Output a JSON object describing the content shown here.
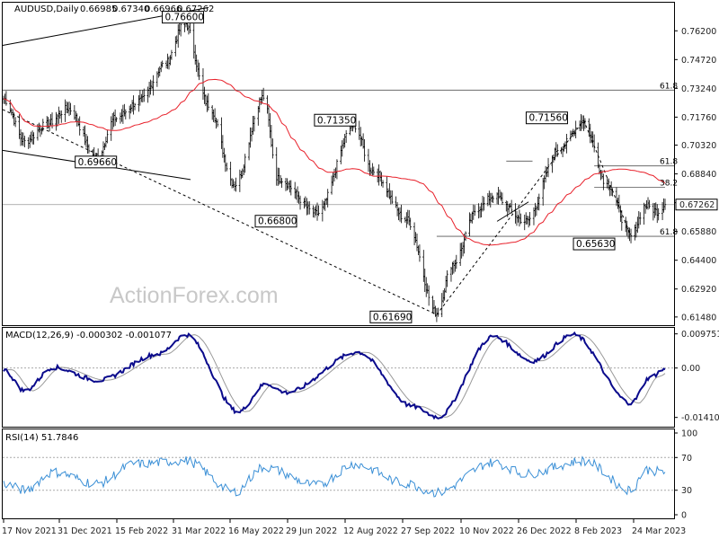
{
  "chart_data": {
    "type": "candlestick",
    "header": {
      "symbol": "AUDUSD,Daily",
      "ohlc": [
        "0.66985",
        "0.67340",
        "0.66966",
        "0.67262"
      ]
    },
    "watermark": "ActionForex.com",
    "colors": {
      "candle": "#000000",
      "sma": "#e8202a",
      "macd_main": "#0a0a8c",
      "macd_signal": "#999999",
      "rsi": "#3a8fd6",
      "levels": "#000000"
    },
    "x_axis": {
      "labels": [
        "17 Nov 2021",
        "31 Dec 2021",
        "15 Feb 2022",
        "31 Mar 2022",
        "16 May 2022",
        "29 Jun 2022",
        "12 Aug 2022",
        "27 Sep 2022",
        "10 Nov 2022",
        "26 Dec 2022",
        "8 Feb 2023",
        "24 Mar 2023"
      ]
    },
    "price_panel": {
      "ylim": [
        0.6115,
        0.776
      ],
      "ticks": [
        "0.76200",
        "0.74720",
        "0.73240",
        "0.71760",
        "0.70320",
        "0.68840",
        "0.67360",
        "0.65880",
        "0.64400",
        "0.62920",
        "0.61480"
      ],
      "current_price": "0.67262",
      "swing_labels": [
        {
          "text": "0.76600",
          "date": "2022-04-04",
          "price": 0.766
        },
        {
          "text": "0.69660",
          "date": "2022-01-27",
          "price": 0.6966
        },
        {
          "text": "0.71350",
          "date": "2022-08-11",
          "price": 0.7135
        },
        {
          "text": "0.66800",
          "date": "2022-07-14",
          "price": 0.668
        },
        {
          "text": "0.61690",
          "date": "2022-10-13",
          "price": 0.6169
        },
        {
          "text": "0.71560",
          "date": "2023-02-02",
          "price": 0.7156
        },
        {
          "text": "0.65630",
          "date": "2023-03-10",
          "price": 0.6563
        }
      ],
      "fib_labels": [
        {
          "text": "61.8",
          "price": 0.7315
        },
        {
          "text": "61.8",
          "price": 0.6925
        },
        {
          "text": "38.2",
          "price": 0.6815
        },
        {
          "text": "61.8",
          "price": 0.6563
        }
      ],
      "key_candles": [
        {
          "date": "2021-11-17",
          "close": 0.727
        },
        {
          "date": "2021-12-03",
          "close": 0.705
        },
        {
          "date": "2021-12-20",
          "close": 0.714
        },
        {
          "date": "2022-01-05",
          "close": 0.722
        },
        {
          "date": "2022-01-27",
          "close": 0.6966
        },
        {
          "date": "2022-02-10",
          "close": 0.717
        },
        {
          "date": "2022-03-01",
          "close": 0.726
        },
        {
          "date": "2022-03-20",
          "close": 0.745
        },
        {
          "date": "2022-04-04",
          "close": 0.766
        },
        {
          "date": "2022-04-22",
          "close": 0.724
        },
        {
          "date": "2022-05-12",
          "close": 0.683
        },
        {
          "date": "2022-06-03",
          "close": 0.728
        },
        {
          "date": "2022-06-14",
          "close": 0.686
        },
        {
          "date": "2022-07-14",
          "close": 0.668
        },
        {
          "date": "2022-08-11",
          "close": 0.7135
        },
        {
          "date": "2022-08-25",
          "close": 0.69
        },
        {
          "date": "2022-09-20",
          "close": 0.665
        },
        {
          "date": "2022-10-13",
          "close": 0.6169
        },
        {
          "date": "2022-10-25",
          "close": 0.642
        },
        {
          "date": "2022-11-14",
          "close": 0.671
        },
        {
          "date": "2022-11-25",
          "close": 0.677
        },
        {
          "date": "2022-12-20",
          "close": 0.664
        },
        {
          "date": "2023-01-15",
          "close": 0.702
        },
        {
          "date": "2023-02-02",
          "close": 0.7156
        },
        {
          "date": "2023-02-20",
          "close": 0.683
        },
        {
          "date": "2023-03-10",
          "close": 0.6563
        },
        {
          "date": "2023-03-21",
          "close": 0.672
        },
        {
          "date": "2023-03-31",
          "close": 0.669
        },
        {
          "date": "2023-04-05",
          "close": 0.6726
        }
      ]
    },
    "macd_panel": {
      "label": "MACD(12,26,9) -0.000302 -0.001077",
      "ticks": [
        "0.009751",
        "0.00",
        "-0.014107"
      ],
      "ylim": [
        -0.0165,
        0.0112
      ],
      "key_values": [
        {
          "date": "2021-11-17",
          "value": -0.0005
        },
        {
          "date": "2021-12-03",
          "value": -0.0065
        },
        {
          "date": "2021-12-25",
          "value": 0.0002
        },
        {
          "date": "2022-01-28",
          "value": -0.0035
        },
        {
          "date": "2022-03-15",
          "value": 0.004
        },
        {
          "date": "2022-04-05",
          "value": 0.0095
        },
        {
          "date": "2022-05-15",
          "value": -0.0125
        },
        {
          "date": "2022-06-05",
          "value": -0.0045
        },
        {
          "date": "2022-06-20",
          "value": -0.007
        },
        {
          "date": "2022-08-14",
          "value": 0.0045
        },
        {
          "date": "2022-09-25",
          "value": -0.011
        },
        {
          "date": "2022-10-14",
          "value": -0.014
        },
        {
          "date": "2022-11-25",
          "value": 0.009
        },
        {
          "date": "2022-12-25",
          "value": 0.002
        },
        {
          "date": "2023-01-25",
          "value": 0.0095
        },
        {
          "date": "2023-03-10",
          "value": -0.01
        },
        {
          "date": "2023-03-25",
          "value": -0.0025
        },
        {
          "date": "2023-04-05",
          "value": -0.0003
        }
      ]
    },
    "rsi_panel": {
      "label": "RSI(14) 51.7846",
      "ticks": [
        "100",
        "70",
        "30",
        "0"
      ],
      "ylim": [
        0,
        100
      ],
      "key_values": [
        {
          "date": "2021-11-17",
          "value": 38
        },
        {
          "date": "2021-12-03",
          "value": 30
        },
        {
          "date": "2021-12-25",
          "value": 52
        },
        {
          "date": "2022-01-27",
          "value": 38
        },
        {
          "date": "2022-02-25",
          "value": 62
        },
        {
          "date": "2022-04-05",
          "value": 66
        },
        {
          "date": "2022-05-12",
          "value": 28
        },
        {
          "date": "2022-06-03",
          "value": 58
        },
        {
          "date": "2022-07-14",
          "value": 36
        },
        {
          "date": "2022-08-11",
          "value": 62
        },
        {
          "date": "2022-09-20",
          "value": 38
        },
        {
          "date": "2022-10-13",
          "value": 27
        },
        {
          "date": "2022-11-25",
          "value": 64
        },
        {
          "date": "2022-12-20",
          "value": 50
        },
        {
          "date": "2023-02-02",
          "value": 66
        },
        {
          "date": "2023-03-10",
          "value": 30
        },
        {
          "date": "2023-03-21",
          "value": 55
        },
        {
          "date": "2023-04-05",
          "value": 51.78
        }
      ]
    }
  }
}
